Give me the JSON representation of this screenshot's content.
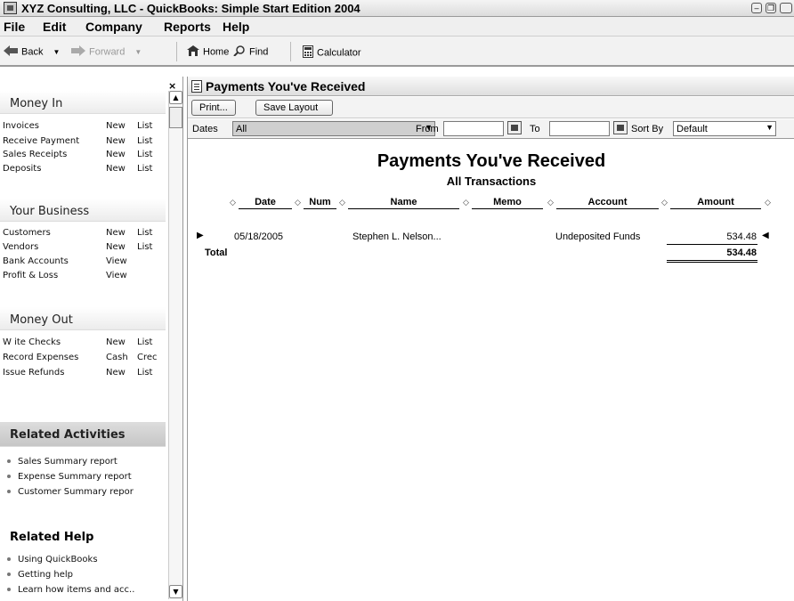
{
  "window": {
    "title": "XYZ Consulting, LLC - QuickBooks: Simple Start Edition 2004",
    "buttons": [
      "minimize",
      "restore",
      "close"
    ]
  },
  "menu": [
    "File",
    "Edit",
    "Company",
    "Reports",
    "Help"
  ],
  "toolbar": {
    "back": "Back",
    "forward": "Forward",
    "home": "Home",
    "find": "Find",
    "calculator": "Calculator"
  },
  "sidebar": {
    "close_glyph": "×",
    "money_in": {
      "title": "Money In",
      "rows": [
        {
          "name": "Invoices",
          "a": "New",
          "b": "List"
        },
        {
          "name": "Receive Payment",
          "a": "New",
          "b": "List"
        },
        {
          "name": "Sales Receipts",
          "a": "New",
          "b": "List"
        },
        {
          "name": "Deposits",
          "a": "New",
          "b": "List"
        }
      ]
    },
    "your_business": {
      "title": "Your Business",
      "rows": [
        {
          "name": "Customers",
          "a": "New",
          "b": "List"
        },
        {
          "name": "Vendors",
          "a": "New",
          "b": "List"
        },
        {
          "name": "Bank Accounts",
          "a": "View",
          "b": ""
        },
        {
          "name": "Profit & Loss",
          "a": "View",
          "b": ""
        }
      ]
    },
    "money_out": {
      "title": "Money Out",
      "rows": [
        {
          "name": "W ite Checks",
          "a": "New",
          "b": "List"
        },
        {
          "name": "Record Expenses",
          "a": "Cash",
          "b": "Crec"
        },
        {
          "name": "Issue Refunds",
          "a": "New",
          "b": "List"
        }
      ]
    },
    "related_activities": {
      "title": "Related Activities",
      "items": [
        "Sales Summary report",
        "Expense Summary report",
        "Customer Summary repor"
      ]
    },
    "related_help": {
      "title": "Related Help",
      "items": [
        "Using QuickBooks",
        "Getting help",
        "Learn how items and acc.."
      ]
    }
  },
  "report_window": {
    "title": "Payments You've Received",
    "buttons": {
      "print": "Print...",
      "save_layout": "Save Layout"
    },
    "filters": {
      "dates_label": "Dates",
      "dates_value": "All",
      "from_label": "From",
      "from_value": "",
      "to_label": "To",
      "to_value": "",
      "sort_label": "Sort By",
      "sort_value": "Default"
    },
    "heading": "Payments You've Received",
    "subheading": "All Transactions",
    "columns": [
      "Date",
      "Num",
      "Name",
      "Memo",
      "Account",
      "Amount"
    ],
    "rows": [
      {
        "date": "05/18/2005",
        "num": "",
        "name": "Stephen L. Nelson...",
        "memo": "",
        "account": "Undeposited Funds",
        "amount": "534.48"
      }
    ],
    "total_label": "Total",
    "total_amount": "534.48"
  }
}
